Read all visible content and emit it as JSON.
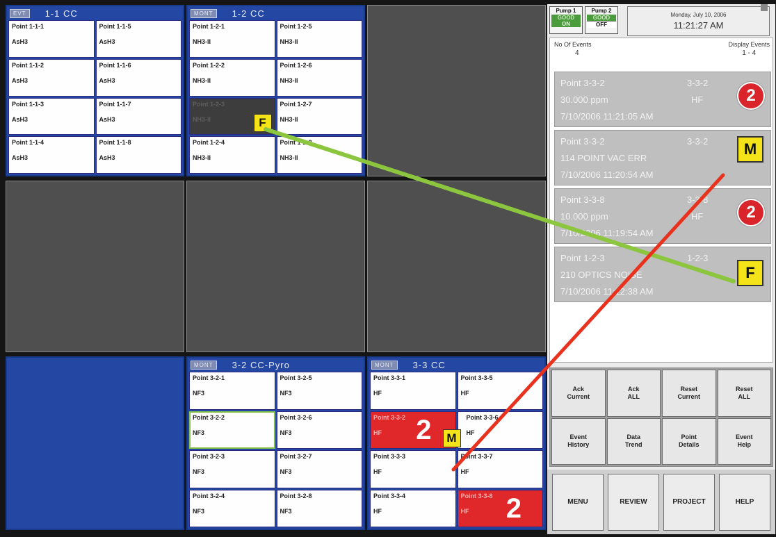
{
  "panels": {
    "p11": {
      "tag": "EVT",
      "title": "1-1  CC",
      "cells": [
        {
          "name": "Point 1-1-1",
          "gas": "AsH3"
        },
        {
          "name": "Point 1-1-5",
          "gas": "AsH3"
        },
        {
          "name": "Point 1-1-2",
          "gas": "AsH3"
        },
        {
          "name": "Point 1-1-6",
          "gas": "AsH3"
        },
        {
          "name": "Point 1-1-3",
          "gas": "AsH3"
        },
        {
          "name": "Point 1-1-7",
          "gas": "AsH3"
        },
        {
          "name": "Point 1-1-4",
          "gas": "AsH3"
        },
        {
          "name": "Point 1-1-8",
          "gas": "AsH3"
        }
      ]
    },
    "p12": {
      "tag": "MONT",
      "title": "1-2  CC",
      "cells": [
        {
          "name": "Point 1-2-1",
          "gas": "NH3-II"
        },
        {
          "name": "Point 1-2-5",
          "gas": "NH3-II"
        },
        {
          "name": "Point 1-2-2",
          "gas": "NH3-II"
        },
        {
          "name": "Point 1-2-6",
          "gas": "NH3-II"
        },
        {
          "name": "Point 1-2-3",
          "gas": "NH3-II"
        },
        {
          "name": "Point 1-2-7",
          "gas": "NH3-II"
        },
        {
          "name": "Point 1-2-4",
          "gas": "NH3-II"
        },
        {
          "name": "Point 1-2-8",
          "gas": "NH3-II"
        }
      ]
    },
    "p32": {
      "tag": "MONT",
      "title": "3-2  CC-Pyro",
      "cells": [
        {
          "name": "Point 3-2-1",
          "gas": "NF3"
        },
        {
          "name": "Point 3-2-5",
          "gas": "NF3"
        },
        {
          "name": "Point 3-2-2",
          "gas": "NF3"
        },
        {
          "name": "Point 3-2-6",
          "gas": "NF3"
        },
        {
          "name": "Point 3-2-3",
          "gas": "NF3"
        },
        {
          "name": "Point 3-2-7",
          "gas": "NF3"
        },
        {
          "name": "Point 3-2-4",
          "gas": "NF3"
        },
        {
          "name": "Point 3-2-8",
          "gas": "NF3"
        }
      ]
    },
    "p33": {
      "tag": "MONT",
      "title": "3-3  CC",
      "cells": [
        {
          "name": "Point 3-3-1",
          "gas": "HF"
        },
        {
          "name": "Point 3-3-5",
          "gas": "HF"
        },
        {
          "name": "Point 3-3-2",
          "gas": "HF"
        },
        {
          "name": "Point 3-3-6",
          "gas": "HF"
        },
        {
          "name": "Point 3-3-3",
          "gas": "HF"
        },
        {
          "name": "Point 3-3-7",
          "gas": "HF"
        },
        {
          "name": "Point 3-3-4",
          "gas": "HF"
        },
        {
          "name": "Point 3-3-8",
          "gas": "HF"
        }
      ]
    }
  },
  "badges": {
    "fault": "F",
    "maintenance": "M",
    "alarm_level": "2"
  },
  "pumps": [
    {
      "label": "Pump 1",
      "state": "GOOD",
      "status": "ON"
    },
    {
      "label": "Pump 2",
      "state": "GOOD",
      "status": "OFF"
    }
  ],
  "datetime": {
    "date": "Monday, July 10, 2006",
    "time": "11:21:27 AM"
  },
  "events_header": {
    "count_label": "No Of Events",
    "count_value": "4",
    "display_label": "Display Events",
    "display_value": "1 - 4"
  },
  "events": [
    {
      "point": "Point 3-3-2",
      "code": "3-3-2",
      "line2": "30.000  ppm",
      "gas": "HF",
      "time": "7/10/2006 11:21:05 AM",
      "badge": "2"
    },
    {
      "point": "Point 3-3-2",
      "code": "3-3-2",
      "line2": "114 POINT VAC ERR",
      "gas": "",
      "time": "7/10/2006 11:20:54 AM",
      "badge": "M"
    },
    {
      "point": "Point 3-3-8",
      "code": "3-3-8",
      "line2": "10.000  ppm",
      "gas": "HF",
      "time": "7/10/2006 11:19:54 AM",
      "badge": "2"
    },
    {
      "point": "Point 1-2-3",
      "code": "1-2-3",
      "line2": "210 OPTICS NOISE",
      "gas": "",
      "time": "7/10/2006 11:12:38 AM",
      "badge": "F"
    }
  ],
  "actions": [
    "Ack\nCurrent",
    "Ack\nALL",
    "Reset\nCurrent",
    "Reset\nALL",
    "Event\nHistory",
    "Data\nTrend",
    "Point\nDetails",
    "Event\nHelp"
  ],
  "nav": [
    "MENU",
    "REVIEW",
    "PROJECT",
    "HELP"
  ],
  "colors": {
    "panel_blue": "#2347a3",
    "alarm_red": "#d8242a",
    "badge_yellow": "#f3e318",
    "link_green": "#8cc63f",
    "link_red": "#e8321e",
    "pump_green": "#4a9b3c"
  }
}
